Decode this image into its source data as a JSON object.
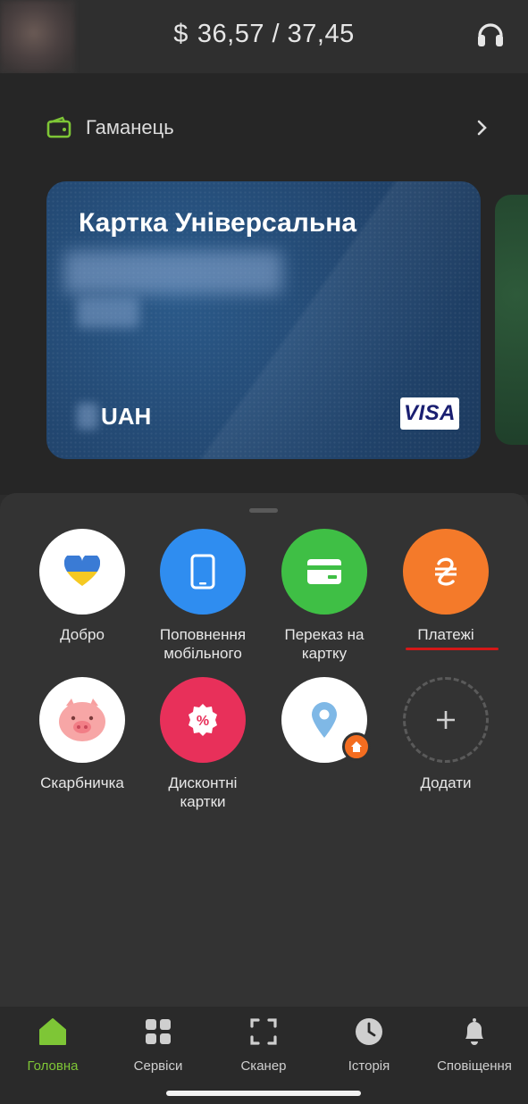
{
  "header": {
    "currency_symbol": "$",
    "rate": "36,57 / 37,45",
    "support_icon": "headset-icon"
  },
  "wallet": {
    "label": "Гаманець",
    "icon": "wallet-icon",
    "accent": "#7ec636"
  },
  "card": {
    "title": "Картка Універсальна",
    "currency": "UAH",
    "network": "VISA",
    "color": "#22466f"
  },
  "services": [
    {
      "label": "Добро",
      "icon": "heart-icon",
      "bg": "#ffffff"
    },
    {
      "label": "Поповнення\nмобільного",
      "icon": "smartphone-icon",
      "bg": "#2f8df0"
    },
    {
      "label": "Переказ на\nкартку",
      "icon": "card-icon",
      "bg": "#3fbf45"
    },
    {
      "label": "Платежі",
      "icon": "hryvnia-icon",
      "bg": "#f47a2a"
    },
    {
      "label": "Скарбничка",
      "icon": "piggy-bank-icon",
      "bg": "#ffffff"
    },
    {
      "label": "Дисконтні\nкартки",
      "icon": "discount-icon",
      "bg": "#e8305a"
    },
    {
      "label": "",
      "icon": "location-pin-icon",
      "bg": "#ffffff"
    },
    {
      "label": "Додати",
      "icon": "plus-icon",
      "bg": "transparent"
    }
  ],
  "nav": [
    {
      "label": "Головна",
      "icon": "home-icon",
      "active": true
    },
    {
      "label": "Сервіси",
      "icon": "grid-icon",
      "active": false
    },
    {
      "label": "Сканер",
      "icon": "scanner-icon",
      "active": false
    },
    {
      "label": "Історія",
      "icon": "clock-icon",
      "active": false
    },
    {
      "label": "Сповіщення",
      "icon": "bell-icon",
      "active": false
    }
  ],
  "colors": {
    "active_nav": "#7ec636",
    "highlight_underline": "#d41818"
  }
}
